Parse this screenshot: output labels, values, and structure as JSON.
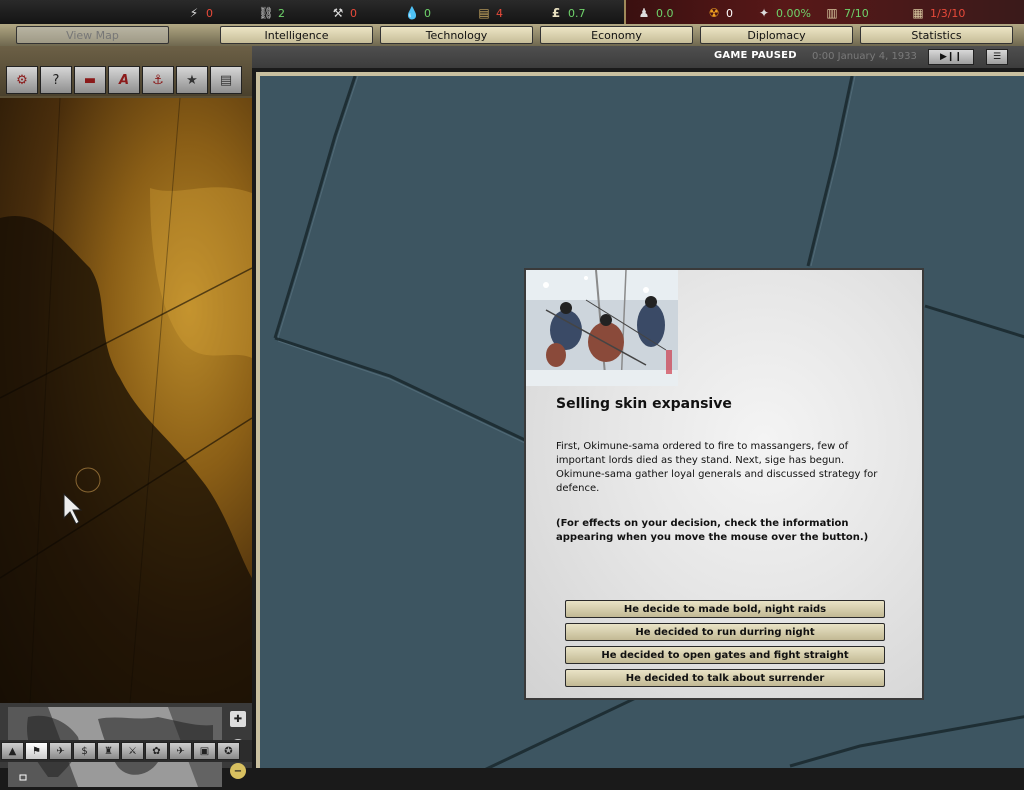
{
  "resources": [
    {
      "icon": "energy-icon",
      "glyph": "⚡",
      "value": "0",
      "tone": "red"
    },
    {
      "icon": "metal-icon",
      "glyph": "⛓",
      "value": "2",
      "tone": "green"
    },
    {
      "icon": "rare-materials-icon",
      "glyph": "⚒",
      "value": "0",
      "tone": "red"
    },
    {
      "icon": "oil-icon",
      "glyph": "💧",
      "value": "0",
      "tone": "green"
    },
    {
      "icon": "supplies-icon",
      "glyph": "▤",
      "value": "4",
      "tone": "red"
    },
    {
      "icon": "money-icon",
      "glyph": "£",
      "value": "0.7",
      "tone": "green"
    }
  ],
  "right_resources": [
    {
      "icon": "manpower-icon",
      "glyph": "♟",
      "value": "0.0",
      "tone": "green"
    },
    {
      "icon": "nuke-icon",
      "glyph": "☢",
      "value": "0",
      "tone": "white"
    },
    {
      "icon": "dissent-icon",
      "glyph": "✦",
      "value": "0.00%",
      "tone": "green"
    },
    {
      "icon": "transport-icon",
      "glyph": "▥",
      "value": "7/10",
      "tone": "green"
    },
    {
      "icon": "convoy-icon",
      "glyph": "▦",
      "value": "1/3/10",
      "tone": "red"
    }
  ],
  "tabs": [
    "View Map",
    "Intelligence",
    "Technology",
    "Economy",
    "Diplomacy",
    "Statistics"
  ],
  "status": {
    "paused": "GAME PAUSED",
    "date": "0:00 January 4, 1933"
  },
  "tools": [
    {
      "name": "production-tool-icon",
      "glyph": "⚙"
    },
    {
      "name": "mission-tool-icon",
      "glyph": "?"
    },
    {
      "name": "army-tool-icon",
      "glyph": "▬"
    },
    {
      "name": "airforce-tool-icon",
      "glyph": "A"
    },
    {
      "name": "navy-tool-icon",
      "glyph": "⚓"
    },
    {
      "name": "leaders-tool-icon",
      "glyph": "★"
    },
    {
      "name": "misc-tool-icon",
      "glyph": "▤"
    }
  ],
  "minimap_filters": [
    "▲",
    "⚑",
    "✈",
    "$",
    "♜",
    "⚔",
    "✿",
    "✈",
    "▣",
    "✪"
  ],
  "event": {
    "title": "Selling skin expansive",
    "text": "First, Okimune-sama ordered to fire to massangers, few of important lords died as they stand. Next, sige has begun. Okimune-sama gather loyal generals and discussed strategy for defence.",
    "note": "(For effects on your decision, check the information appearing when you move the mouse over the button.)",
    "options": [
      "He decide to made bold, night raids",
      "He decided to run durring night",
      "He decided to open gates and fight straight",
      "He decided to talk about surrender"
    ]
  },
  "colors": {
    "sea": "#3d5561",
    "tab_bg": "#d9d1ae",
    "dialog_bg": "#e6e6e6"
  }
}
